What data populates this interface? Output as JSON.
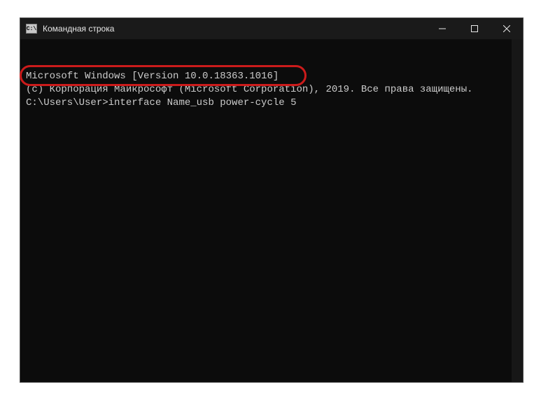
{
  "titlebar": {
    "icon_label": "C:\\",
    "title": "Командная строка"
  },
  "terminal": {
    "line1": "Microsoft Windows [Version 10.0.18363.1016]",
    "line2": "(c) Корпорация Майкрософт (Microsoft Corporation), 2019. Все права защищены.",
    "blank": "",
    "prompt": "C:\\Users\\User>",
    "command": "interface Name_usb power-cycle 5"
  }
}
